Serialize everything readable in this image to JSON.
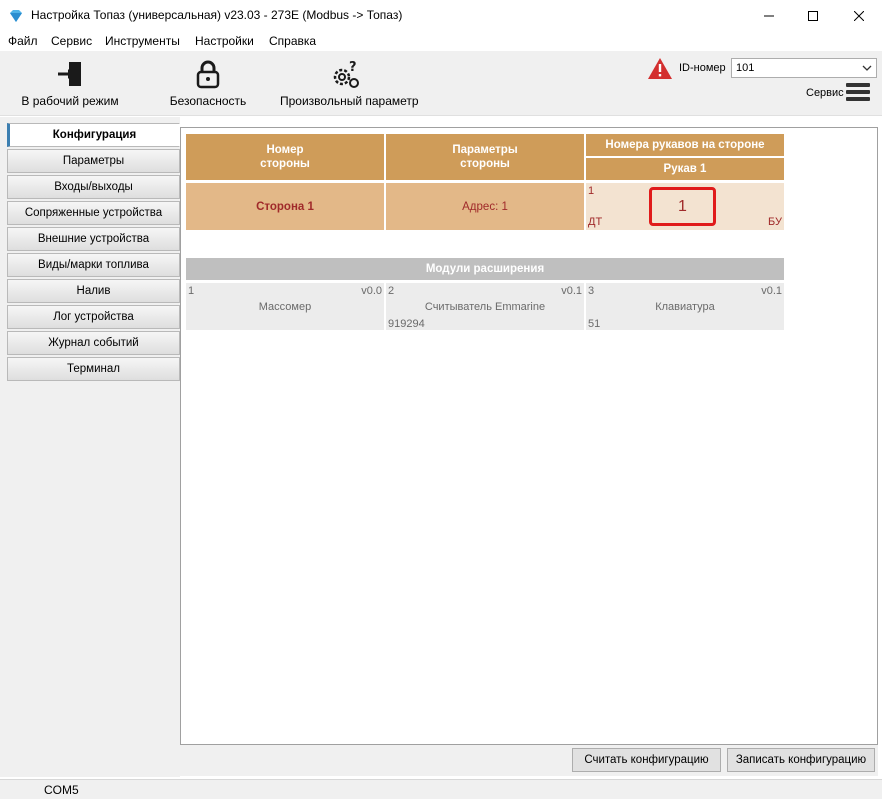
{
  "window": {
    "title": "Настройка Топаз (универсальная) v23.03 - 273E (Modbus -> Топаз)"
  },
  "menu": [
    "Файл",
    "Сервис",
    "Инструменты",
    "Настройки",
    "Справка"
  ],
  "toolbar": {
    "work_mode": "В рабочий режим",
    "security": "Безопасность",
    "custom_param": "Произвольный параметр",
    "id_label": "ID-номер",
    "id_value": "101",
    "service": "Сервис"
  },
  "sidebar": {
    "items": [
      {
        "label": "Конфигурация"
      },
      {
        "label": "Параметры"
      },
      {
        "label": "Входы/выходы"
      },
      {
        "label": "Сопряженные устройства"
      },
      {
        "label": "Внешние устройства"
      },
      {
        "label": "Виды/марки топлива"
      },
      {
        "label": "Налив"
      },
      {
        "label": "Лог устройства"
      },
      {
        "label": "Журнал событий"
      },
      {
        "label": "Терминал"
      }
    ]
  },
  "config": {
    "head_side_number": "Номер стороны",
    "head_side_params": "Параметры стороны",
    "head_hoses": "Номера рукавов на стороне",
    "head_hose1": "Рукав 1",
    "side_name": "Сторона 1",
    "side_address": "Адрес: 1",
    "hose_top": "1",
    "hose_fuel": "ДТ",
    "hose_unit": "БУ",
    "hose_number": "1"
  },
  "modules": {
    "title": "Модули расширения",
    "items": [
      {
        "num": "1",
        "ver": "v0.0",
        "name": "Массомер",
        "serial": ""
      },
      {
        "num": "2",
        "ver": "v0.1",
        "name": "Считыватель Emmarine",
        "serial": "919294"
      },
      {
        "num": "3",
        "ver": "v0.1",
        "name": "Клавиатура",
        "serial": "51"
      }
    ]
  },
  "buttons": {
    "read": "Считать конфигурацию",
    "write": "Записать конфигурацию"
  },
  "status": {
    "port": "COM5"
  },
  "colors": {
    "header_tan": "#cf9c59",
    "cell_tan": "#e3b888",
    "cell_light": "#f3e3d1",
    "highlight_red": "#e01b1b",
    "active_tab_accent": "#3c7fb1"
  }
}
